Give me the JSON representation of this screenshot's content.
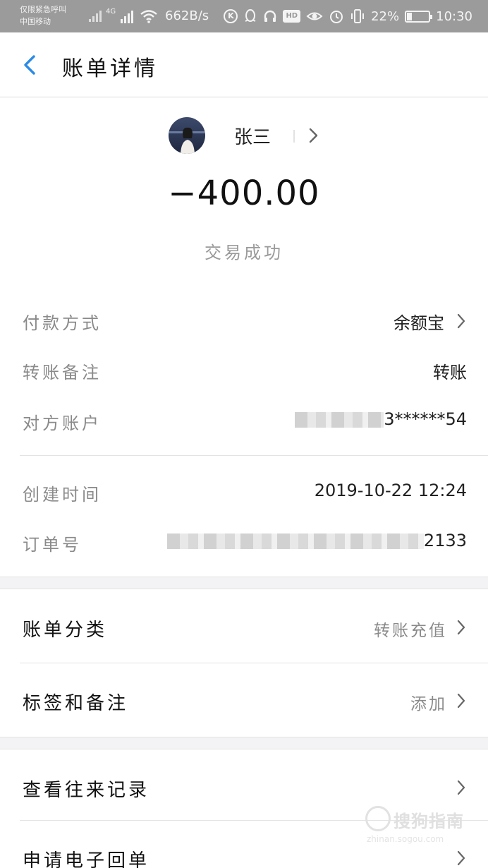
{
  "status_bar": {
    "carrier_line1": "仅限紧急呼叫",
    "carrier_line2": "中国移动",
    "network_type": "4G",
    "net_speed": "662B/s",
    "battery": "22%",
    "battery_level": 0.22,
    "time": "10:30"
  },
  "header": {
    "title": "账单详情"
  },
  "payee": {
    "name": "张三"
  },
  "amount": "−400.00",
  "status": "交易成功",
  "details": {
    "payment_method_label": "付款方式",
    "payment_method_value": "余额宝",
    "remark_label": "转账备注",
    "remark_value": "转账",
    "account_label": "对方账户",
    "account_value": "3******54",
    "created_label": "创建时间",
    "created_value": "2019-10-22 12:24",
    "order_label": "订单号",
    "order_value": "2133"
  },
  "actions": {
    "category_label": "账单分类",
    "category_value": "转账充值",
    "tags_label": "标签和备注",
    "tags_value": "添加",
    "history_label": "查看往来记录",
    "receipt_label": "申请电子回单"
  },
  "watermark": {
    "text": "搜狗指南",
    "sub": "zhinan.sogou.com"
  },
  "colors": {
    "accent": "#2a8ae8",
    "status_bar": "#9b9b9b"
  }
}
